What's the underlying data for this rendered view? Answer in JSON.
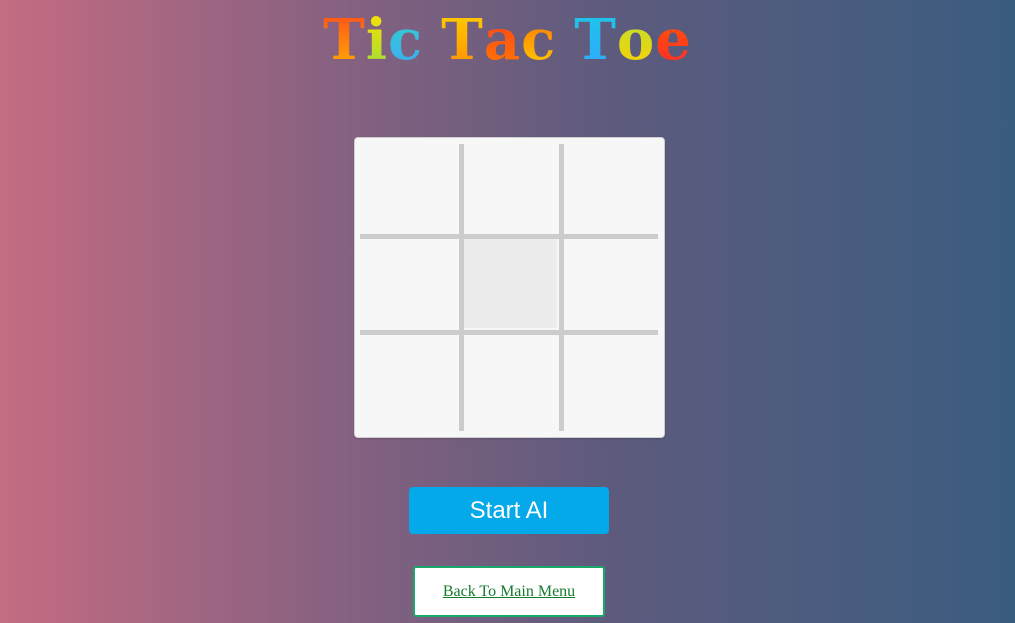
{
  "title": {
    "word1": "Tic",
    "word2": "Tac",
    "word3": "Toe",
    "letters": [
      "T",
      "i",
      "c",
      "T",
      "a",
      "c",
      "T",
      "o",
      "e"
    ]
  },
  "board": {
    "cells": [
      "",
      "",
      "",
      "",
      "",
      "",
      "",
      "",
      ""
    ],
    "highlighted_cell": 4
  },
  "buttons": {
    "start_ai": "Start AI",
    "back_to_menu": "Back To Main Menu"
  },
  "colors": {
    "start_button": "#03a9e8",
    "back_button_border": "#1aa86a",
    "back_button_text": "#167a2f",
    "board_background": "#f7f7f7",
    "grid_lines": "#cccccc"
  }
}
